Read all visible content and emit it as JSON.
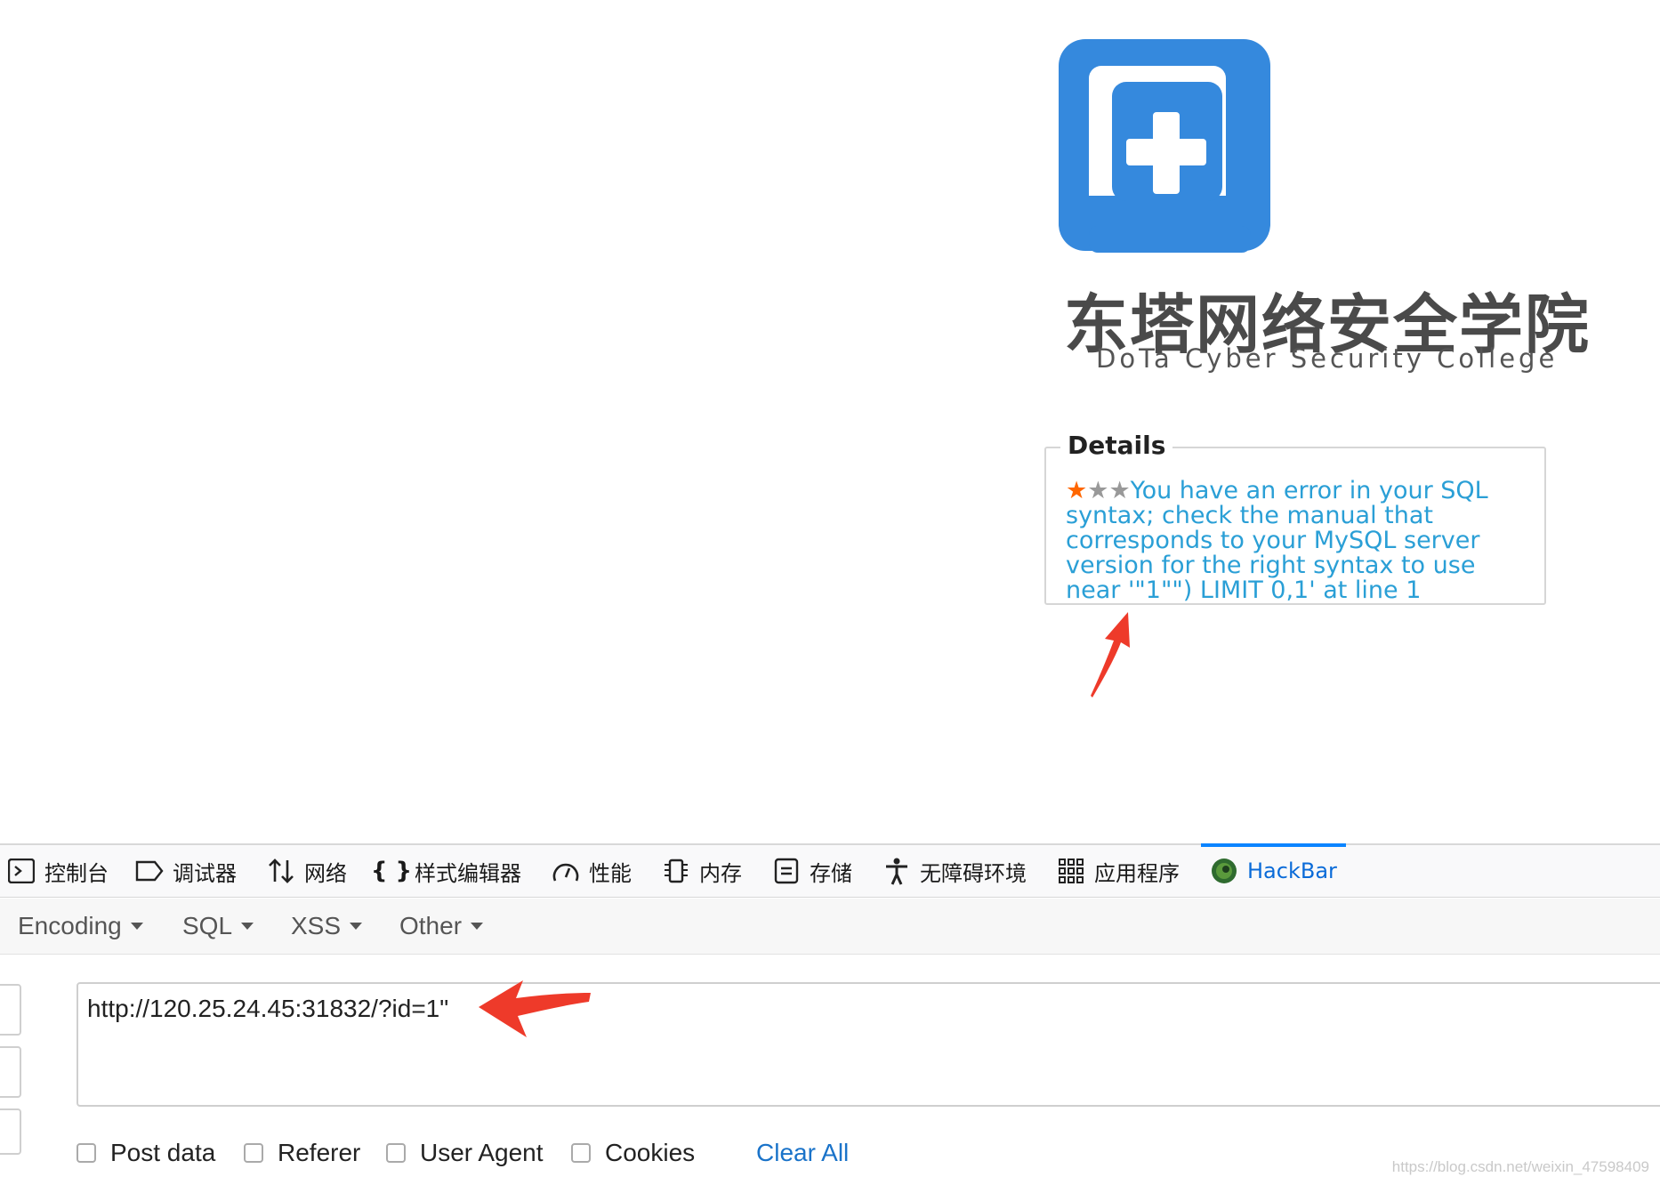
{
  "brand": {
    "name_cn": "东塔网络安全学院",
    "name_en": "DoTa Cyber Security College",
    "logo_color": "#3589dd"
  },
  "details": {
    "legend": "Details",
    "stars_filled": 1,
    "stars_total": 3,
    "message": "You have an error in your SQL syntax; check the manual that corresponds to your MySQL server version for the right syntax to use near '\"1\"\") LIMIT 0,1' at line 1"
  },
  "devtools": {
    "tabs": [
      {
        "label": "控制台",
        "icon": "console-icon"
      },
      {
        "label": "调试器",
        "icon": "debugger-icon"
      },
      {
        "label": "网络",
        "icon": "network-icon"
      },
      {
        "label": "样式编辑器",
        "icon": "style-editor-icon"
      },
      {
        "label": "性能",
        "icon": "performance-icon"
      },
      {
        "label": "内存",
        "icon": "memory-icon"
      },
      {
        "label": "存储",
        "icon": "storage-icon"
      },
      {
        "label": "无障碍环境",
        "icon": "accessibility-icon"
      },
      {
        "label": "应用程序",
        "icon": "application-icon"
      },
      {
        "label": "HackBar",
        "icon": "hackbar-icon",
        "active": true
      }
    ],
    "active_color": "#0a84ff"
  },
  "hackbar": {
    "menu": [
      "Encoding",
      "SQL",
      "XSS",
      "Other"
    ],
    "url": "http://120.25.24.45:31832/?id=1\"",
    "options": [
      "Post data",
      "Referer",
      "User Agent",
      "Cookies"
    ],
    "clear_all": "Clear All"
  },
  "watermark": "https://blog.csdn.net/weixin_47598409",
  "annotation_color": "#ee3a2a"
}
